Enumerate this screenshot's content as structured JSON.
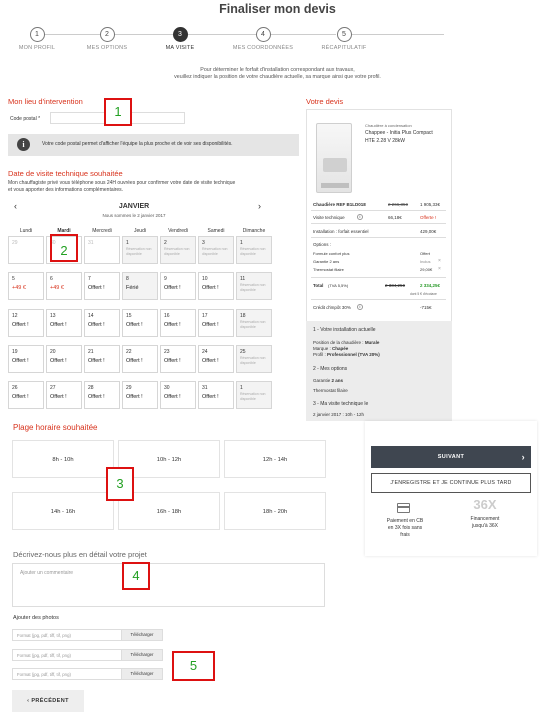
{
  "page": {
    "title": "Finaliser mon devis"
  },
  "stepper": [
    {
      "num": "1",
      "label": "MON PROFIL"
    },
    {
      "num": "2",
      "label": "MES OPTIONS"
    },
    {
      "num": "3",
      "label": "MA VISITE"
    },
    {
      "num": "4",
      "label": "MES COORDONNÉES"
    },
    {
      "num": "5",
      "label": "RÉCAPITULATIF"
    }
  ],
  "intro": {
    "line1": "Pour déterminer le forfait d'installation correspondant aux travaux,",
    "line2": "veuillez indiquer la position de votre chaudière actuelle, sa marque ainsi que votre profil."
  },
  "intervention": {
    "title": "Mon lieu d'intervention",
    "postal_label": "Code postal *",
    "postal_value": "",
    "info_icon": "info-icon",
    "info_text": "Votre code postal permet d'afficher l'équipe la plus proche et de voir ses disponibilités."
  },
  "visit": {
    "title": "Date de visite technique souhaitée",
    "desc1": "Mon chauffagiste privé vous téléphone sous 24H ouvrées pour confirmer votre date de visite technique",
    "desc2": "et vous apporter des informations complémentaires.",
    "month": "JANVIER",
    "today_text": "Nous sommes le 2 janvier 2017",
    "prev_arrow": "‹",
    "next_arrow": "›",
    "days": [
      "Lundi",
      "Mardi",
      "Mercredi",
      "Jeudi",
      "Vendredi",
      "Samedi",
      "Dimanche"
    ],
    "weeks": [
      [
        {
          "n": "29",
          "t": ""
        },
        {
          "n": "30",
          "t": ""
        },
        {
          "n": "31",
          "t": ""
        },
        {
          "n": "1",
          "t": "Réservation non disponible"
        },
        {
          "n": "2",
          "t": "Réservation non disponible"
        },
        {
          "n": "3",
          "t": "Réservation non disponible"
        },
        {
          "n": "1",
          "t": "Réservation non disponible"
        }
      ],
      [
        {
          "n": "5",
          "t": "+49 €"
        },
        {
          "n": "6",
          "t": "+49 €"
        },
        {
          "n": "7",
          "t": "Offert !"
        },
        {
          "n": "8",
          "t": "Férié"
        },
        {
          "n": "9",
          "t": "Offert !"
        },
        {
          "n": "10",
          "t": "Offert !"
        },
        {
          "n": "11",
          "t": "Réservation non disponible"
        }
      ],
      [
        {
          "n": "12",
          "t": "Offert !"
        },
        {
          "n": "13",
          "t": "Offert !"
        },
        {
          "n": "14",
          "t": "Offert !"
        },
        {
          "n": "15",
          "t": "Offert !"
        },
        {
          "n": "16",
          "t": "Offert !"
        },
        {
          "n": "17",
          "t": "Offert !"
        },
        {
          "n": "18",
          "t": "Réservation non disponible"
        }
      ],
      [
        {
          "n": "19",
          "t": "Offert !"
        },
        {
          "n": "20",
          "t": "Offert !"
        },
        {
          "n": "21",
          "t": "Offert !"
        },
        {
          "n": "22",
          "t": "Offert !"
        },
        {
          "n": "23",
          "t": "Offert !"
        },
        {
          "n": "24",
          "t": "Offert !"
        },
        {
          "n": "25",
          "t": "Réservation non disponible"
        }
      ],
      [
        {
          "n": "26",
          "t": "Offert !"
        },
        {
          "n": "27",
          "t": "Offert !"
        },
        {
          "n": "28",
          "t": "Offert !"
        },
        {
          "n": "29",
          "t": "Offert !"
        },
        {
          "n": "30",
          "t": "Offert !"
        },
        {
          "n": "31",
          "t": "Offert !"
        },
        {
          "n": "1",
          "t": "Réservation non disponible"
        }
      ]
    ]
  },
  "devis": {
    "title": "Votre devis",
    "product_type": "Chaudière à condensation",
    "product_name1": "Chappee - Initia Plus Compact",
    "product_name2": "HTE 2.28 V  28kW",
    "ref_label": "Chaudière REF B1LD018",
    "ref_old": "2 266,35€",
    "ref_price": "1 905,33€",
    "visite_label": "Visite technique",
    "visite_old": "66,18€",
    "visite_price": "Offerte !",
    "install_label": "Installation : forfait essentiel",
    "install_price": "429,00€",
    "options_label": "Options :",
    "opt1_label": "Formule confort plus",
    "opt1_price": "Offert",
    "opt2_label": "Garantie 2 ans",
    "opt2_price": "Inclus",
    "opt3_label": "Thermostat filaire",
    "opt3_price": "29,00€",
    "total_label": "Total",
    "total_tva": "(TVA 5,5%)",
    "total_old": "2 334,25€",
    "total_price": "2 334,25€",
    "total_saving": "dont 5 € d'écotaxe",
    "credit_label": "Crédit d'impôt 30%",
    "credit_price": "-715€",
    "s1_title": "1 - Votre installation actuelle",
    "s1_pos_label": "Position de la chaudière :",
    "s1_pos_val": "Murale",
    "s1_brand_label": "Marque :",
    "s1_brand_val": "Chapée",
    "s1_profile_label": "Profil :",
    "s1_profile_val": "Professionnel (TVA 20%)",
    "s2_title": "2 - Mes options",
    "s2_line1_label": "Garantie",
    "s2_line1_val": "2 ans",
    "s2_line2": "Thermostat filaire",
    "s3_title": "3 - Ma visite technique le",
    "s3_date": "2 janvier 2017 : 10h - 12h"
  },
  "timeslot": {
    "title": "Plage horaire souhaitée",
    "slots": [
      "8h - 10h",
      "10h - 12h",
      "12h - 14h",
      "14h - 16h",
      "16h - 18h",
      "18h - 20h"
    ]
  },
  "actions": {
    "next": "SUIVANT",
    "next_arrow": "›",
    "save_later": "J'ENREGISTRE ET JE CONTINUE PLUS TARD",
    "pay_cb_1": "Paiement en CB",
    "pay_cb_2": "en 3X fois sans frais",
    "financing_big": "36X",
    "financing_1": "Financement",
    "financing_2": "jusqu'à 36X",
    "prev": "PRÉCÉDENT",
    "prev_arrow": "‹"
  },
  "project": {
    "title": "Décrivez-nous plus en détail votre projet",
    "comment_placeholder": "Ajouter un commentaire",
    "photos_title": "Ajouter des photos",
    "file_placeholder": "Format (jpg, pdf, tiff, tif, png)",
    "upload_label": "Télécharger"
  },
  "markers": [
    "1",
    "2",
    "3",
    "4",
    "5"
  ]
}
